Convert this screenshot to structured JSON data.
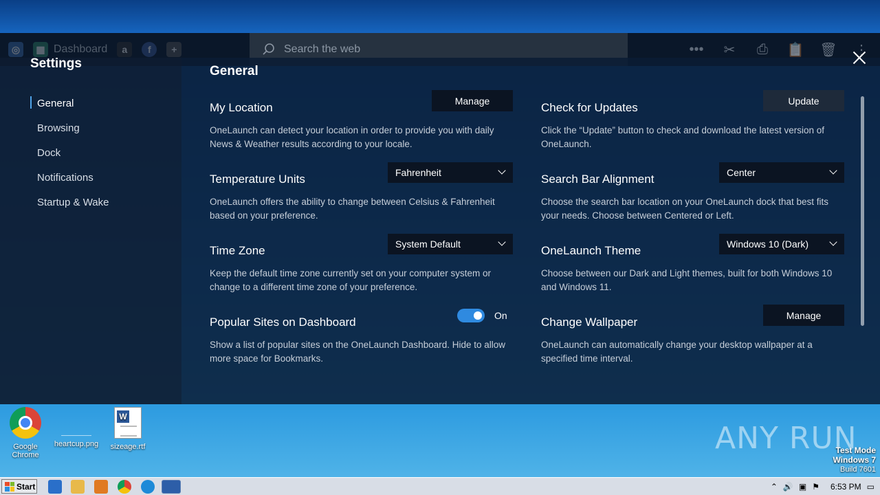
{
  "dock": {
    "dashboard_label": "Dashboard",
    "search_placeholder": "Search the web",
    "more_icon": "more-icon",
    "icons": [
      "scissors-icon",
      "printer-icon",
      "clipboard-icon",
      "trash-icon",
      "vertical-dots-icon"
    ]
  },
  "sidebar": {
    "title": "Settings",
    "items": [
      {
        "label": "General",
        "active": true
      },
      {
        "label": "Browsing",
        "active": false
      },
      {
        "label": "Dock",
        "active": false
      },
      {
        "label": "Notifications",
        "active": false
      },
      {
        "label": "Startup & Wake",
        "active": false
      }
    ]
  },
  "main": {
    "title": "General",
    "settings": {
      "my_location": {
        "label": "My Location",
        "button": "Manage",
        "desc": "OneLaunch can detect your location in order to provide you with daily News & Weather results according to your locale."
      },
      "check_updates": {
        "label": "Check for Updates",
        "button": "Update",
        "desc": "Click the “Update” button to check and download the latest version of OneLaunch."
      },
      "temperature_units": {
        "label": "Temperature Units",
        "value": "Fahrenheit",
        "desc": "OneLaunch offers the ability to change between Celsius & Fahrenheit based on your preference."
      },
      "search_bar_alignment": {
        "label": "Search Bar Alignment",
        "value": "Center",
        "desc": "Choose the search bar location on your OneLaunch dock that best fits your needs. Choose between Centered or Left."
      },
      "time_zone": {
        "label": "Time Zone",
        "value": "System Default",
        "desc": "Keep the default time zone currently set on your computer system or change to a different time zone of your preference."
      },
      "theme": {
        "label": "OneLaunch Theme",
        "value": "Windows 10 (Dark)",
        "desc": "Choose between our Dark and Light themes, built for both Windows 10 and Windows 11."
      },
      "popular_sites": {
        "label": "Popular Sites on Dashboard",
        "toggle_state": "On",
        "desc": "Show a list of popular sites on the OneLaunch Dashboard. Hide to allow more space for Bookmarks."
      },
      "wallpaper": {
        "label": "Change Wallpaper",
        "button": "Manage",
        "desc": "OneLaunch can automatically change your desktop wallpaper at a specified time interval."
      }
    }
  },
  "desktop": {
    "icons": [
      {
        "label": "Google Chrome"
      },
      {
        "label": "heartcup.png"
      },
      {
        "label": "sizeage.rtf"
      }
    ],
    "watermark": "ANY RUN",
    "test_mode": "Test Mode",
    "os": "Windows 7",
    "build": "Build 7601"
  },
  "taskbar": {
    "start_label": "Start",
    "clock": "6:53 PM"
  },
  "colors": {
    "accent": "#2f8ae0",
    "panel": "#0a1c34",
    "control_bg": "#0b1422"
  }
}
